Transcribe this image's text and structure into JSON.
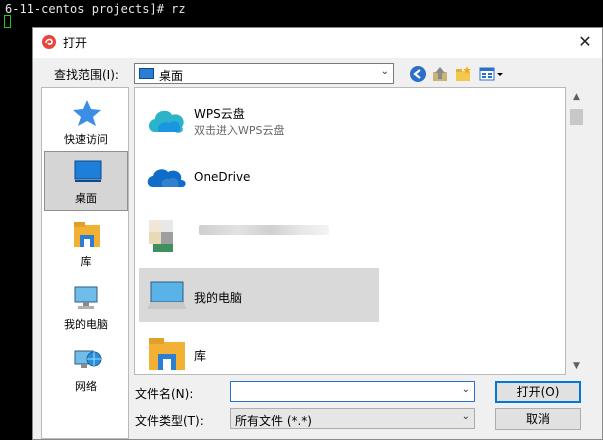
{
  "terminal": {
    "prompt_line": "6-11-centos projects]# rz"
  },
  "dialog": {
    "title": "打开",
    "close_symbol": "✕",
    "look_in": {
      "label": "查找范围(I):",
      "value": "桌面"
    },
    "toolbar": {
      "icons": [
        "back-icon",
        "up-folder-icon",
        "new-folder-icon",
        "view-menu-icon"
      ]
    },
    "places": [
      {
        "label": "快速访问",
        "icon": "star-icon"
      },
      {
        "label": "桌面",
        "icon": "desktop-icon",
        "selected": true
      },
      {
        "label": "库",
        "icon": "library-icon"
      },
      {
        "label": "我的电脑",
        "icon": "computer-icon"
      },
      {
        "label": "网络",
        "icon": "network-icon"
      }
    ],
    "files": [
      {
        "name": "WPS云盘",
        "sub": "双击进入WPS云盘",
        "icon": "wps-cloud-icon"
      },
      {
        "name": "OneDrive",
        "sub": "",
        "icon": "onedrive-icon"
      },
      {
        "name": "",
        "sub": "",
        "icon": "blurred-icon"
      },
      {
        "name": "我的电脑",
        "sub": "",
        "icon": "computer-icon",
        "selected": true
      },
      {
        "name": "库",
        "sub": "",
        "icon": "library-icon"
      }
    ],
    "filename": {
      "label": "文件名(N):",
      "value": "",
      "placeholder": ""
    },
    "filetype": {
      "label": "文件类型(T):",
      "value": "所有文件 (*.*)"
    },
    "buttons": {
      "open": "打开(O)",
      "cancel": "取消"
    },
    "colors": {
      "accent": "#0078d7",
      "selection": "#d9d9d9"
    }
  }
}
